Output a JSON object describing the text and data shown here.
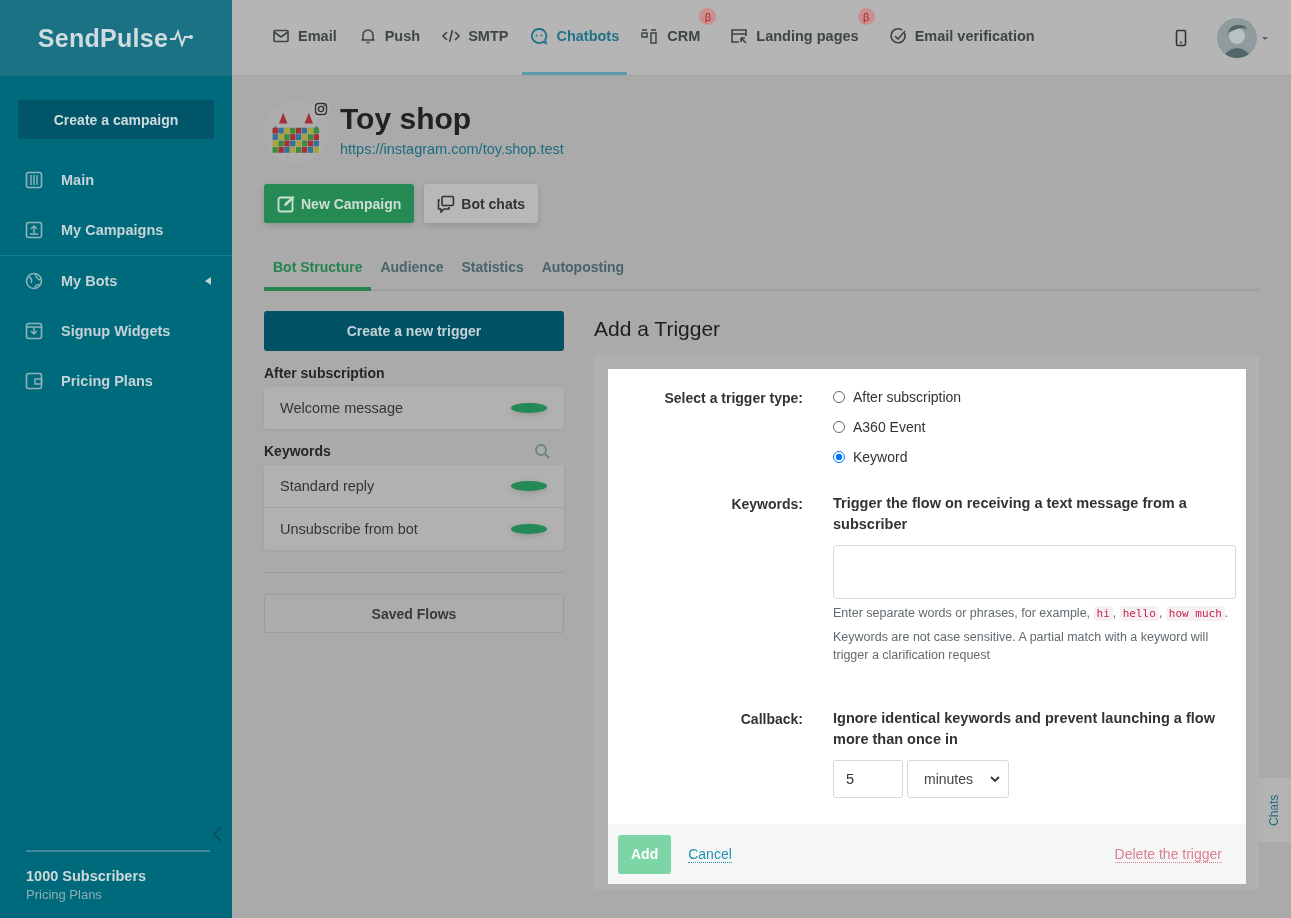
{
  "brand": {
    "name": "SendPulse"
  },
  "nav": [
    {
      "label": "Email",
      "selected": false
    },
    {
      "label": "Push",
      "selected": false
    },
    {
      "label": "SMTP",
      "selected": false
    },
    {
      "label": "Chatbots",
      "selected": true
    },
    {
      "label": "CRM",
      "selected": false,
      "badge": "β"
    },
    {
      "label": "Landing pages",
      "selected": false,
      "badge": "β"
    },
    {
      "label": "Email verification",
      "selected": false
    }
  ],
  "sidebar": {
    "create_button": "Create a campaign",
    "items": [
      {
        "label": "Main",
        "expandable": false
      },
      {
        "label": "My Campaigns",
        "expandable": false
      },
      {
        "label": "My Bots",
        "expandable": true
      },
      {
        "label": "Signup Widgets",
        "expandable": false
      },
      {
        "label": "Pricing Plans",
        "expandable": false
      }
    ],
    "plan": {
      "title": "1000 Subscribers",
      "link": "Pricing Plans"
    }
  },
  "bot": {
    "name": "Toy shop",
    "url": "https://instagram.com/toy.shop.test"
  },
  "actions": [
    {
      "label": "New Campaign",
      "kind": "primary"
    },
    {
      "label": "Bot chats",
      "kind": "secondary"
    }
  ],
  "tabs": [
    {
      "label": "Bot Structure",
      "selected": true
    },
    {
      "label": "Audience",
      "selected": false
    },
    {
      "label": "Statistics",
      "selected": false
    },
    {
      "label": "Autoposting",
      "selected": false
    }
  ],
  "triggers": {
    "create_button": "Create a new trigger",
    "groups": [
      {
        "title": "After subscription",
        "searchable": false,
        "items": [
          {
            "label": "Welcome message",
            "active": true
          }
        ]
      },
      {
        "title": "Keywords",
        "searchable": true,
        "items": [
          {
            "label": "Standard reply",
            "active": true
          },
          {
            "label": "Unsubscribe from bot",
            "active": true
          }
        ]
      }
    ],
    "saved_flows": "Saved Flows"
  },
  "form": {
    "title": "Add a Trigger",
    "type_label": "Select a trigger type:",
    "types": [
      {
        "label": "After subscription",
        "selected": false
      },
      {
        "label": "A360 Event",
        "selected": false
      },
      {
        "label": "Keyword",
        "selected": true
      }
    ],
    "keywords_label": "Keywords:",
    "keywords_title": "Trigger the flow on receiving a text message from a subscriber",
    "keywords_hint": [
      {
        "text": "Enter separate words or phrases, for example, ",
        "kind": "text"
      },
      {
        "text": "hi",
        "kind": "code"
      },
      {
        "text": ", ",
        "kind": "text"
      },
      {
        "text": "hello",
        "kind": "code"
      },
      {
        "text": ", ",
        "kind": "text"
      },
      {
        "text": "how much",
        "kind": "code"
      },
      {
        "text": ".",
        "kind": "text"
      }
    ],
    "keywords_note": "Keywords are not case sensitive. A partial match with a keyword will trigger a clarification request",
    "callback_label": "Callback:",
    "callback_title": "Ignore identical keywords and prevent launching a flow more than once in",
    "callback_value": "5",
    "callback_unit": "minutes",
    "add_button": {
      "label": "Add",
      "disabled": true
    },
    "cancel": "Cancel",
    "delete": "Delete the trigger"
  },
  "chats_tab": "Chats"
}
